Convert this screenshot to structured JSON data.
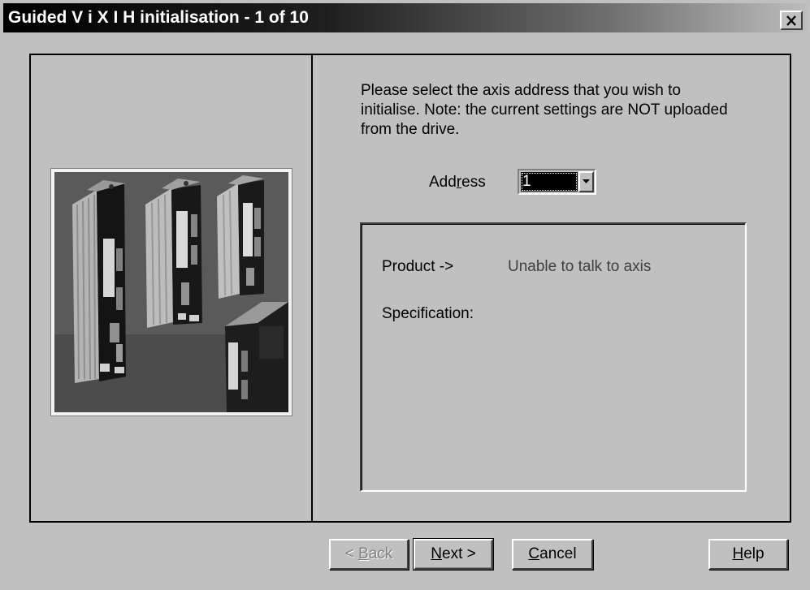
{
  "window": {
    "title": "Guided V i X I H initialisation - 1 of 10",
    "close_icon": "close-x-icon"
  },
  "intro": {
    "text": "Please select the axis address that you wish to initialise.  Note: the current settings are NOT uploaded from the drive."
  },
  "address": {
    "label_pre": "Add",
    "label_accel": "r",
    "label_post": "ess",
    "value": "1",
    "dropdown_icon": "chevron-down-icon"
  },
  "info": {
    "product_label": "Product ->",
    "product_value": "Unable to talk to axis",
    "spec_label": "Specification:"
  },
  "buttons": {
    "back": {
      "pre": "< ",
      "accel": "B",
      "post": "ack",
      "enabled": false
    },
    "next": {
      "pre": "",
      "accel": "N",
      "post": "ext >",
      "enabled": true,
      "default": true
    },
    "cancel": {
      "pre": "",
      "accel": "C",
      "post": "ancel",
      "enabled": true
    },
    "help": {
      "pre": "",
      "accel": "H",
      "post": "elp",
      "enabled": true
    }
  },
  "image": {
    "subject": "servo-drive-units-photo"
  }
}
